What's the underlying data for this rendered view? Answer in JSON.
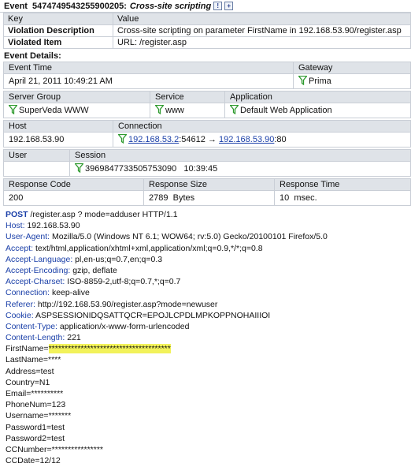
{
  "event": {
    "prefix": "Event",
    "id": "5474749543255900205:",
    "title": "Cross-site scripting",
    "icons": [
      "exclamation-icon",
      "tag-icon"
    ]
  },
  "kv": {
    "header_key": "Key",
    "header_value": "Value",
    "rows": [
      {
        "key": "Violation Description",
        "value": "Cross-site scripting on parameter FirstName in 192.168.53.90/register.asp"
      },
      {
        "key": "Violated Item",
        "value": "URL: /register.asp"
      }
    ]
  },
  "details_label": "Event Details:",
  "time_gateway": {
    "event_time_header": "Event Time",
    "event_time": "April 21, 2011 10:49:21 AM",
    "gateway_header": "Gateway",
    "gateway": "Prima"
  },
  "server": {
    "server_group_header": "Server Group",
    "server_group": "SuperVeda WWW",
    "service_header": "Service",
    "service": "www",
    "application_header": "Application",
    "application": "Default Web Application"
  },
  "host_conn": {
    "host_header": "Host",
    "host": "192.168.53.90",
    "connection_header": "Connection",
    "src_ip": "192.168.53.2",
    "src_port": ":54612",
    "arrow": "→",
    "dst_ip": "192.168.53.90",
    "dst_port": ":80"
  },
  "user_session": {
    "user_header": "User",
    "user": "",
    "session_header": "Session",
    "session_id": "3969847733505753090",
    "session_time": "10:39:45"
  },
  "response": {
    "code_header": "Response Code",
    "code": "200",
    "size_header": "Response Size",
    "size_value": "2789",
    "size_unit": "Bytes",
    "time_header": "Response Time",
    "time_value": "10",
    "time_unit": "msec."
  },
  "request": {
    "method": "POST",
    "request_line": " /register.asp ? mode=adduser   HTTP/1.1",
    "headers": [
      {
        "name": "Host",
        "value": "192.168.53.90"
      },
      {
        "name": "User-Agent",
        "value": "Mozilla/5.0 (Windows NT 6.1; WOW64; rv:5.0) Gecko/20100101 Firefox/5.0"
      },
      {
        "name": "Accept",
        "value": "text/html,application/xhtml+xml,application/xml;q=0.9,*/*;q=0.8"
      },
      {
        "name": "Accept-Language",
        "value": "pl,en-us;q=0.7,en;q=0.3"
      },
      {
        "name": "Accept-Encoding",
        "value": "gzip, deflate"
      },
      {
        "name": "Accept-Charset",
        "value": "ISO-8859-2,utf-8;q=0.7,*;q=0.7"
      },
      {
        "name": "Connection",
        "value": "keep-alive"
      },
      {
        "name": "Referer",
        "value": "http://192.168.53.90/register.asp?mode=newuser"
      },
      {
        "name": "Cookie",
        "value": "ASPSESSIONIDQSATTQCR=EPOJLCPDLMPKOPPNOHAIIIOI"
      },
      {
        "name": "Content-Type",
        "value": "application/x-www-form-urlencoded"
      },
      {
        "name": "Content-Length",
        "value": "221"
      }
    ],
    "body": {
      "firstname_label": "FirstName=",
      "firstname_value": "**************************************",
      "lines": [
        "LastName=****",
        "Address=test",
        "Country=N1",
        "Email=**********",
        "PhoneNum=123",
        "Username=*******",
        "Password1=test",
        "Password2=test",
        "CCNumber=****************",
        "CCDate=12/12"
      ]
    }
  },
  "colors": {
    "header_bg": "#dfe3e8",
    "link": "#1a3fa8",
    "highlight": "#f2f25a",
    "filter_icon": "#2e9a2e"
  }
}
